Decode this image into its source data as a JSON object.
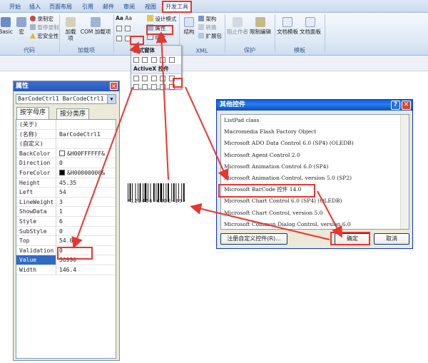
{
  "ribbon": {
    "tabs": [
      "开始",
      "插入",
      "页面布局",
      "引用",
      "邮件",
      "审阅",
      "视图",
      "开发工具"
    ],
    "active_tab": "开发工具",
    "groups": {
      "code": {
        "label": "代码",
        "basic_label": "Basic",
        "macro_label": "宏",
        "record_macro": "录制宏",
        "pause_record": "暂停录制",
        "macro_security": "宏安全性"
      },
      "addins": {
        "label": "加载项",
        "addins_btn": "加载项",
        "com_addins_btn": "COM 加载项"
      },
      "controls": {
        "design_mode": "设计模式",
        "properties": "属性",
        "group_btn": "组合"
      },
      "xml": {
        "label": "XML",
        "structure": "结构",
        "schema": "架构",
        "transform": "转换",
        "expansion_pack": "扩展包"
      },
      "protect": {
        "label": "保护",
        "block_authors": "阻止作者",
        "restrict_editing": "限制编辑"
      },
      "templates": {
        "label": "模板",
        "doc_template": "文档模板",
        "doc_panel": "文档面板"
      }
    }
  },
  "controls_dropdown": {
    "legacy_header": "旧式窗体",
    "activex_header": "ActiveX 控件"
  },
  "properties_window": {
    "title": "属性",
    "object_combo": "BarCodeCtrl1 BarCodeCtrl1",
    "tab_alpha": "按字母序",
    "tab_category": "按分类序",
    "rows": [
      {
        "name": "(关于)",
        "value": ""
      },
      {
        "name": "(名称)",
        "value": "BarCodeCtrl1"
      },
      {
        "name": "(自定义)",
        "value": ""
      },
      {
        "name": "BackColor",
        "value": "&H00FFFFFF&"
      },
      {
        "name": "Direction",
        "value": "0"
      },
      {
        "name": "ForeColor",
        "value": "&H00000000&"
      },
      {
        "name": "Height",
        "value": "45.35"
      },
      {
        "name": "Left",
        "value": "54"
      },
      {
        "name": "LineWeight",
        "value": "3"
      },
      {
        "name": "ShowData",
        "value": "1"
      },
      {
        "name": "Style",
        "value": "6"
      },
      {
        "name": "SubStyle",
        "value": "0"
      },
      {
        "name": "Top",
        "value": "54.6"
      },
      {
        "name": "Validation",
        "value": "0"
      },
      {
        "name": "Value",
        "value": "36990"
      },
      {
        "name": "Width",
        "value": "146.4"
      }
    ],
    "colors": {
      "backcolor": "#ffffff",
      "forecolor": "#000000"
    }
  },
  "barcode": {
    "text": "*123456 CODE-39*"
  },
  "dialog": {
    "title": "其他控件",
    "help": "?",
    "close": "✕",
    "items": [
      "ListPad class",
      "Macromedia Flash Factory Object",
      "Microsoft ADO Data Control 6.0 (SP4) (OLEDB)",
      "Microsoft Agent Control 2.0",
      "Microsoft Animation Control 6.0 (SP4)",
      "Microsoft Animation Control, version 5.0 (SP2)",
      "Microsoft BarCode 控件 14.0",
      "Microsoft Chart Control 6.0 (SP4) (OLEDB)",
      "Microsoft Chart Control, version 5.0",
      "Microsoft Common Dialog Control, version 6.0"
    ],
    "selected_index": 6,
    "register_btn": "注册自定义控件(R)...",
    "ok_btn": "确定",
    "cancel_btn": "取消"
  },
  "colors": {
    "annotation_red": "#e8352f",
    "title_blue": "#2b7af0",
    "selection_blue": "#316ac5"
  }
}
